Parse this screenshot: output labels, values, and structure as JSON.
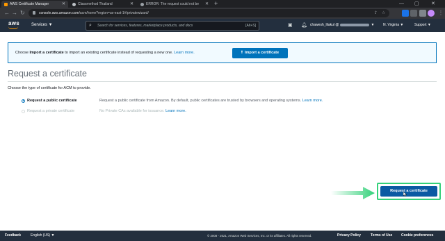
{
  "browser": {
    "tabs": [
      {
        "title": "AWS Certificate Manager",
        "active": true,
        "favicon_color": "#ff9900"
      },
      {
        "title": "Classmethod Thailand",
        "active": false,
        "favicon_color": "#bdc1c6"
      },
      {
        "title": "ERROR: The request could not be",
        "active": false,
        "favicon_color": "#9aa0a6"
      }
    ],
    "new_tab": "+",
    "address": {
      "host": "console.aws.amazon.com",
      "path": "/acm/home?region=us-east-1#/privatewizard/"
    }
  },
  "aws_header": {
    "logo": "aws",
    "services": "Services ▼",
    "search_placeholder": "Search for services, features, marketplace products, and docs",
    "search_shortcut": "[Alt+S]",
    "account_prefix": "chawesh_lilakul @",
    "region": "N. Virginia ▼",
    "support": "Support ▼"
  },
  "import_banner": {
    "text_before": "Choose ",
    "text_bold": "Import a certificate",
    "text_after": " to import an existing certificate instead of requesting a new one. ",
    "learn_more": "Learn more.",
    "button_label": "Import a certificate"
  },
  "page": {
    "title": "Request a certificate",
    "subtitle": "Choose the type of certificate for ACM to provide."
  },
  "options": [
    {
      "label": "Request a public certificate",
      "description": "Request a public certificate from Amazon. By default, public certificates are trusted by browsers and operating systems.",
      "learn_more": "Learn more.",
      "selected": true,
      "enabled": true
    },
    {
      "label": "Request a private certificate",
      "description": "No Private CAs available for issuance.",
      "learn_more": "Learn more.",
      "selected": false,
      "enabled": false
    }
  ],
  "actions": {
    "request_button": "Request a certificate"
  },
  "footer": {
    "feedback": "Feedback",
    "language": "English (US) ▼",
    "copyright": "© 2008 - 2021, Amazon Web Services, Inc. or its affiliates. All rights reserved.",
    "privacy": "Privacy Policy",
    "terms": "Terms of Use",
    "cookies": "Cookie preferences"
  },
  "colors": {
    "aws_nav": "#232f3e",
    "aws_orange": "#ff9900",
    "link_blue": "#0073bb",
    "highlight_green": "#34d17a"
  }
}
